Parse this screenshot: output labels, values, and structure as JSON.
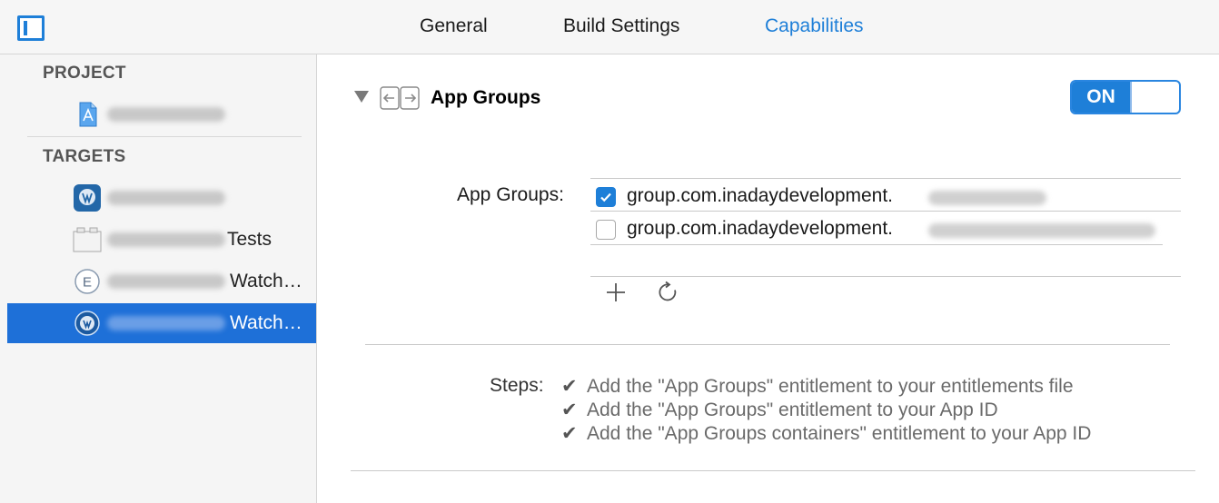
{
  "tabs": [
    {
      "label": "General",
      "active": false
    },
    {
      "label": "Build Settings",
      "active": false
    },
    {
      "label": "Capabilities",
      "active": true
    }
  ],
  "sidebar": {
    "project_header": "PROJECT",
    "targets_header": "TARGETS",
    "items": [
      {
        "suffix": "",
        "icon": "project-file-icon"
      },
      {
        "suffix": "",
        "icon": "app-target-icon"
      },
      {
        "suffix": "Tests",
        "icon": "test-bundle-icon"
      },
      {
        "suffix": "Watch…",
        "icon": "extension-icon"
      },
      {
        "suffix": "Watch…",
        "icon": "watch-app-icon",
        "selected": true
      }
    ]
  },
  "capability": {
    "title": "App Groups",
    "toggle_label": "ON",
    "groups_label": "App Groups:",
    "groups": [
      {
        "prefix": "group.com.inadaydevelopment.",
        "checked": true
      },
      {
        "prefix": "group.com.inadaydevelopment.",
        "checked": false
      }
    ],
    "steps_label": "Steps:",
    "steps": [
      "Add the \"App Groups\" entitlement to your entitlements file",
      "Add the \"App Groups\" entitlement to your App ID",
      "Add the \"App Groups containers\" entitlement to your App ID"
    ]
  },
  "colors": {
    "accent": "#1e7fd8",
    "selection": "#1e70d8"
  }
}
